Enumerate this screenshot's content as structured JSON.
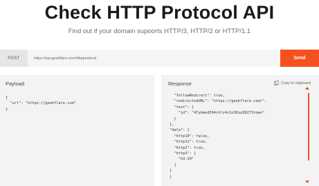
{
  "header": {
    "title": "Check HTTP Protocol API",
    "subtitle": "Find out if your domain supoorts HTTP/3, HTTP/2 or HTTP/1.1"
  },
  "request": {
    "method": "POST",
    "url": "https://api.geekflare.com/httpprotocol",
    "send_label": "Send"
  },
  "payload": {
    "title": "Payload",
    "code": "{\n  \"url\": \"https://geekflare.com\"\n}"
  },
  "response": {
    "title": "Response",
    "copy_label": "Copy to clipboard",
    "code": "  \"followRedirect\": true,\n  \"redirectedURL\": \"https://geekflare.com/\",\n  \"test\": {\n    \"id\": \"47ykmed504rhlz4z1n36zu58273rmao\"\n  }\n},\n\"data\": {\n  \"http10\": false,\n  \"http11\": true,\n  \"http2\": true,\n  \"http3\": [\n    \"h3-29\"\n  ]\n}\n}"
  },
  "colors": {
    "accent": "#f4511e",
    "panel_bg": "#f3f3f3"
  }
}
